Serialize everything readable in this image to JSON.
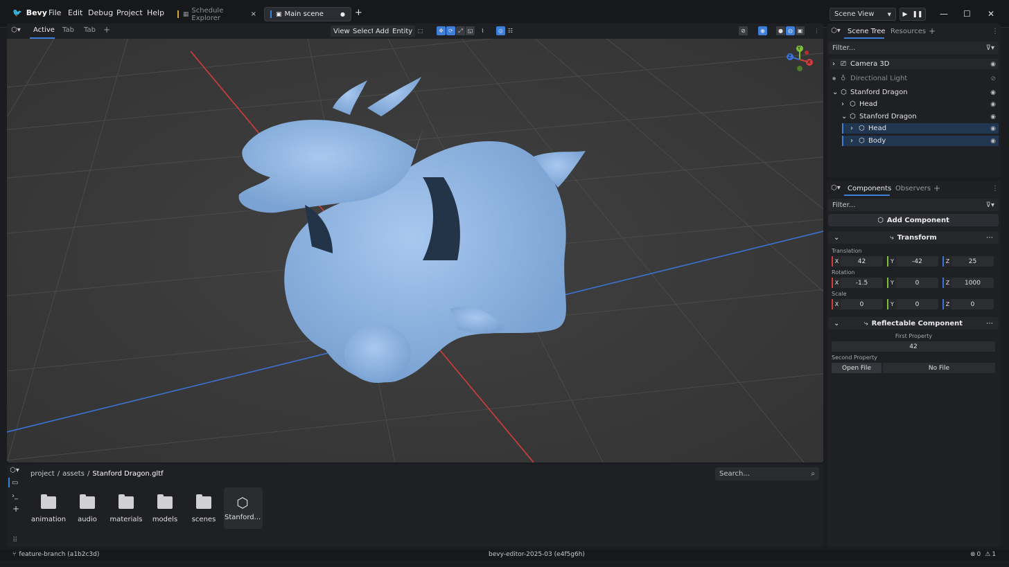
{
  "app": {
    "name": "Bevy"
  },
  "menu": [
    "File",
    "Edit",
    "Debug",
    "Project",
    "Help"
  ],
  "doc_tabs": [
    {
      "label": "Schedule Explorer",
      "close": "×"
    },
    {
      "label": "Main scene",
      "dirty": "●"
    }
  ],
  "add_tab": "+",
  "scene_select": {
    "value": "Scene View"
  },
  "viewport": {
    "tabs": [
      "Active",
      "Tab",
      "Tab"
    ],
    "add": "+",
    "menus": [
      "View",
      "Select",
      "Add",
      "Entity"
    ],
    "gizmo": {
      "y": "Y",
      "x": "X",
      "z": "Z"
    }
  },
  "scene_tree": {
    "tabs": [
      "Scene Tree",
      "Resources"
    ],
    "add": "+",
    "filter_placeholder": "Filter...",
    "items": [
      {
        "label": "Camera 3D"
      },
      {
        "label": "Directional Light"
      },
      {
        "label": "Stanford Dragon"
      },
      {
        "label": "Head"
      },
      {
        "label": "Stanford Dragon"
      },
      {
        "label": "Head"
      },
      {
        "label": "Body"
      }
    ]
  },
  "inspector": {
    "tabs": [
      "Components",
      "Observers"
    ],
    "add": "+",
    "filter_placeholder": "Filter...",
    "add_component": "Add Component",
    "transform": {
      "title": "Transform",
      "translation_label": "Translation",
      "rotation_label": "Rotation",
      "scale_label": "Scale",
      "axes": [
        "X",
        "Y",
        "Z"
      ],
      "translation": [
        "42",
        "-42",
        "25"
      ],
      "rotation": [
        "-1.5",
        "0",
        "1000"
      ],
      "scale": [
        "0",
        "0",
        "0"
      ]
    },
    "reflectable": {
      "title": "Reflectable Component",
      "first_label": "First Property",
      "first_value": "42",
      "second_label": "Second Property",
      "open_file": "Open File",
      "no_file": "No File"
    }
  },
  "assets": {
    "breadcrumb": [
      "project",
      "assets",
      "Stanford Dragon.gltf"
    ],
    "separator": "/",
    "search_placeholder": "Search...",
    "items": [
      "animation",
      "audio",
      "materials",
      "models",
      "scenes",
      "Stanford..."
    ]
  },
  "status": {
    "branch": "feature-branch (a1b2c3d)",
    "version": "bevy-editor-2025-03 (e4f5g6h)",
    "errors": "0",
    "warnings": "1"
  },
  "colors": {
    "accent": "#3d7fd9",
    "dragon": "#8fb6e3",
    "axis_x": "#d23c3c",
    "axis_z": "#3b73d6"
  }
}
